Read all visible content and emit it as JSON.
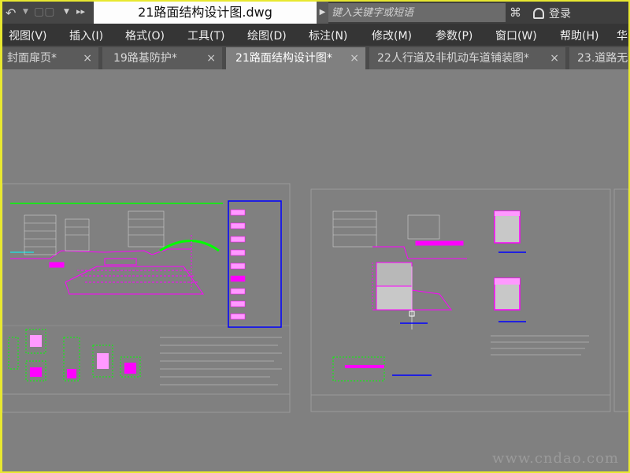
{
  "window": {
    "title": "21路面结构设计图.dwg",
    "search_placeholder": "键入关键字或短语",
    "login_label": "登录"
  },
  "icons": {
    "back": "back-arrow-icon",
    "dropdown": "dropdown-icon",
    "more": "expand-icon",
    "binoculars": "binoculars-icon",
    "user": "user-icon"
  },
  "menu": [
    {
      "label": "视图(V)"
    },
    {
      "label": "插入(I)"
    },
    {
      "label": "格式(O)"
    },
    {
      "label": "工具(T)"
    },
    {
      "label": "绘图(D)"
    },
    {
      "label": "标注(N)"
    },
    {
      "label": "修改(M)"
    },
    {
      "label": "参数(P)"
    },
    {
      "label": "窗口(W)"
    },
    {
      "label": "帮助(H)"
    },
    {
      "label": "华"
    }
  ],
  "tabs": [
    {
      "label": "封面扉页*",
      "active": false
    },
    {
      "label": "19路基防护*",
      "active": false
    },
    {
      "label": "21路面结构设计图*",
      "active": true
    },
    {
      "label": "22人行道及非机动车道铺装图*",
      "active": false
    },
    {
      "label": "23.道路无",
      "active": false
    }
  ],
  "close_glyph": "×",
  "watermark": "www.cndao.com",
  "colors": {
    "title_bar": "#3e3e3e",
    "menu_bar": "#353535",
    "tab_bar": "#4a4a4a",
    "canvas": "#808080",
    "outer_border": "#e8e830",
    "drawing_magenta": "#ff00ff",
    "drawing_green": "#00ff00",
    "drawing_blue": "#0000ff"
  }
}
